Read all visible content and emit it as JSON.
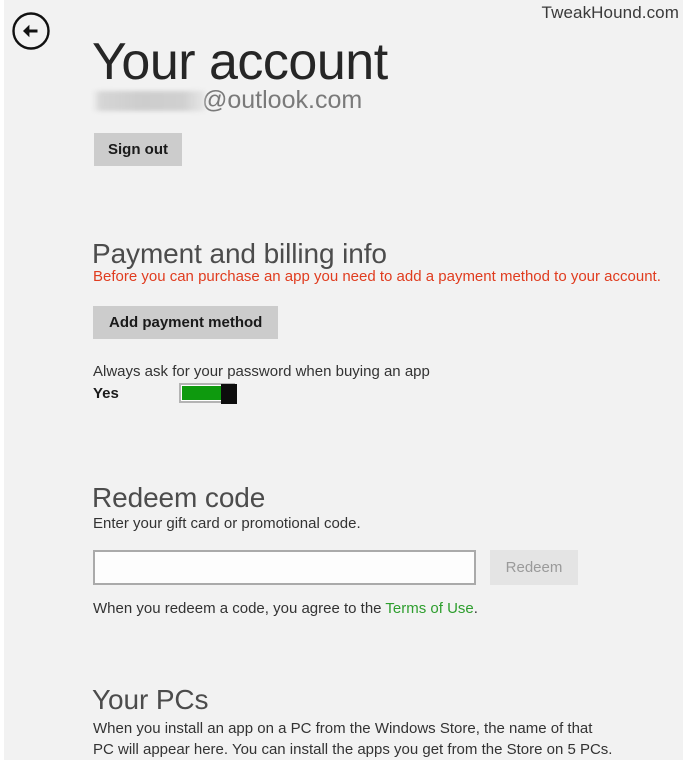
{
  "watermark": "TweakHound.com",
  "header": {
    "back_icon": "back-arrow-circle-icon",
    "title": "Your account"
  },
  "account": {
    "email_redacted": "",
    "email_domain": "@outlook.com",
    "sign_out_label": "Sign out"
  },
  "payment": {
    "heading": "Payment and billing info",
    "warning": "Before you can purchase an app you need to add a payment method to your account.",
    "warning_color": "#e03c1f",
    "add_payment_label": "Add payment method",
    "password_label": "Always ask for your password when buying an app",
    "toggle_state_label": "Yes",
    "toggle_on": true,
    "toggle_on_color": "#0e9a0e"
  },
  "redeem": {
    "heading": "Redeem code",
    "description": "Enter your gift card or promotional code.",
    "input_value": "",
    "input_placeholder": "",
    "button_label": "Redeem",
    "button_disabled": true,
    "terms_prefix": "When you redeem a code, you agree to the ",
    "terms_link": "Terms of Use",
    "terms_suffix": ".",
    "link_color": "#2e9e2e"
  },
  "your_pcs": {
    "heading": "Your PCs",
    "description": "When you install an app on a PC from the Windows Store, the name of that PC will appear here. You can install the apps you get from the Store on 5 PCs."
  }
}
